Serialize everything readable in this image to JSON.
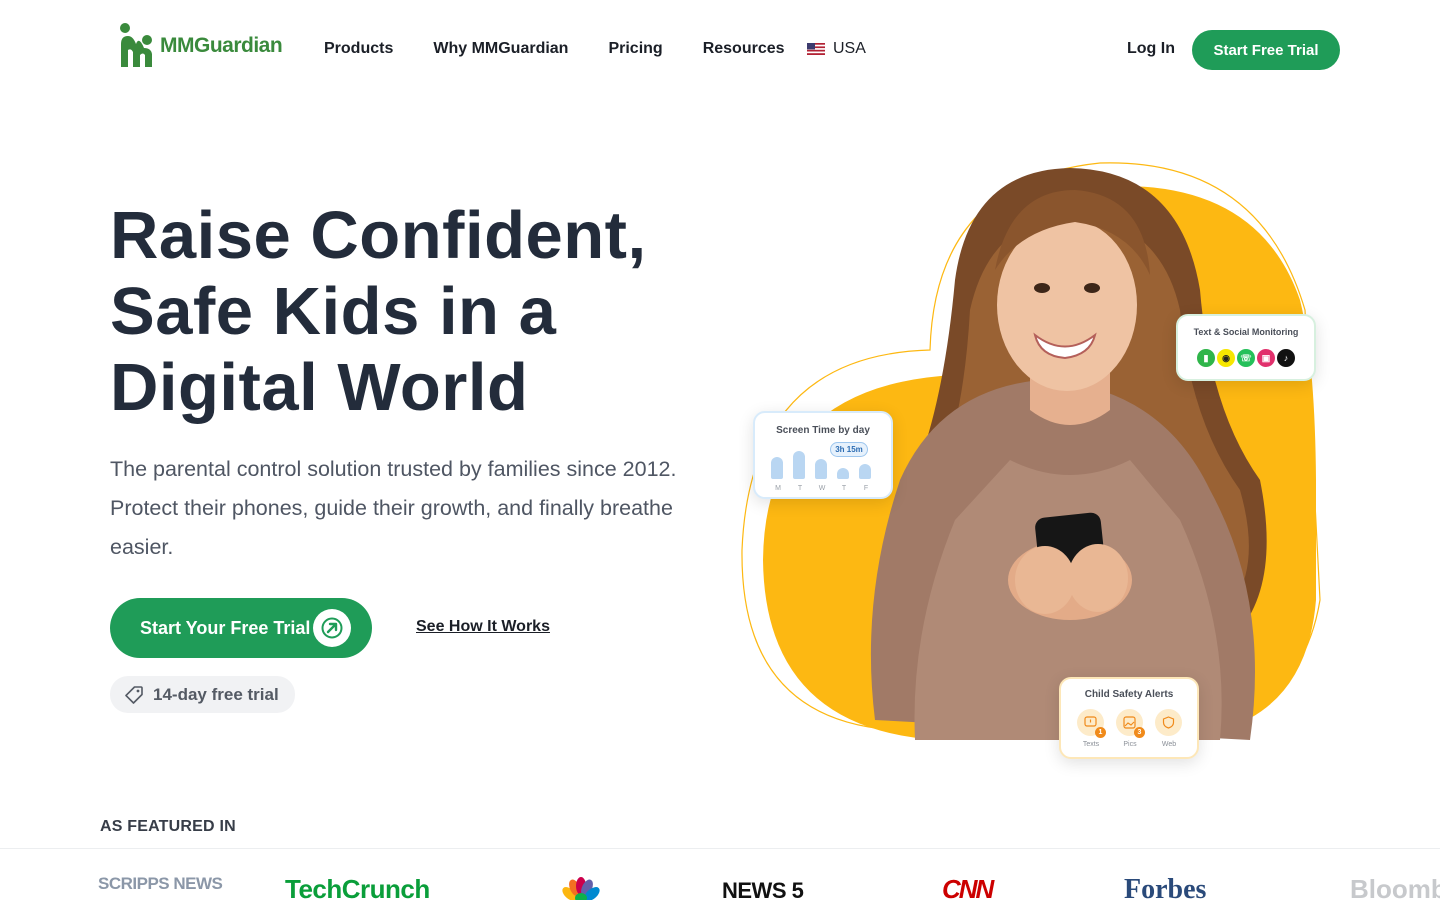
{
  "brand": {
    "name": "MMGuardian",
    "color": "#3a8a3c"
  },
  "nav": {
    "links": [
      "Products",
      "Why MMGuardian",
      "Pricing",
      "Resources"
    ],
    "country": "USA",
    "login": "Log In",
    "cta": "Start Free Trial"
  },
  "hero": {
    "title": "Raise Confident, Safe Kids in a Digital World",
    "subtitle": "The parental control solution trusted by families since 2012. Protect their phones, guide their growth, and finally breathe easier.",
    "cta_primary": "Start Your Free Trial",
    "cta_secondary": "See How It Works",
    "trial_badge": "14-day free trial"
  },
  "cards": {
    "screen_time": {
      "title": "Screen Time by day",
      "badge": "3h 15m",
      "days": [
        "M",
        "T",
        "W",
        "T",
        "F"
      ]
    },
    "social": {
      "title": "Text & Social Monitoring",
      "icons": [
        "messages-icon",
        "snapchat-icon",
        "whatsapp-icon",
        "instagram-icon",
        "tiktok-icon"
      ]
    },
    "alerts": {
      "title": "Child Safety Alerts",
      "items": [
        {
          "label": "Texts",
          "count": "1",
          "icon": "message-alert-icon"
        },
        {
          "label": "Pics",
          "count": "3",
          "icon": "image-alert-icon"
        },
        {
          "label": "Web",
          "count": "",
          "icon": "shield-icon"
        }
      ]
    }
  },
  "featured": {
    "label": "AS FEATURED IN",
    "outlets": [
      "SCRIPPS NEWS",
      "TechCrunch",
      "NBC",
      "NEWS 5",
      "CNN",
      "Forbes",
      "Bloomberg"
    ]
  },
  "colors": {
    "primary_green": "#1f9c58",
    "accent_yellow": "#fdb812",
    "text_dark": "#232c3b"
  }
}
